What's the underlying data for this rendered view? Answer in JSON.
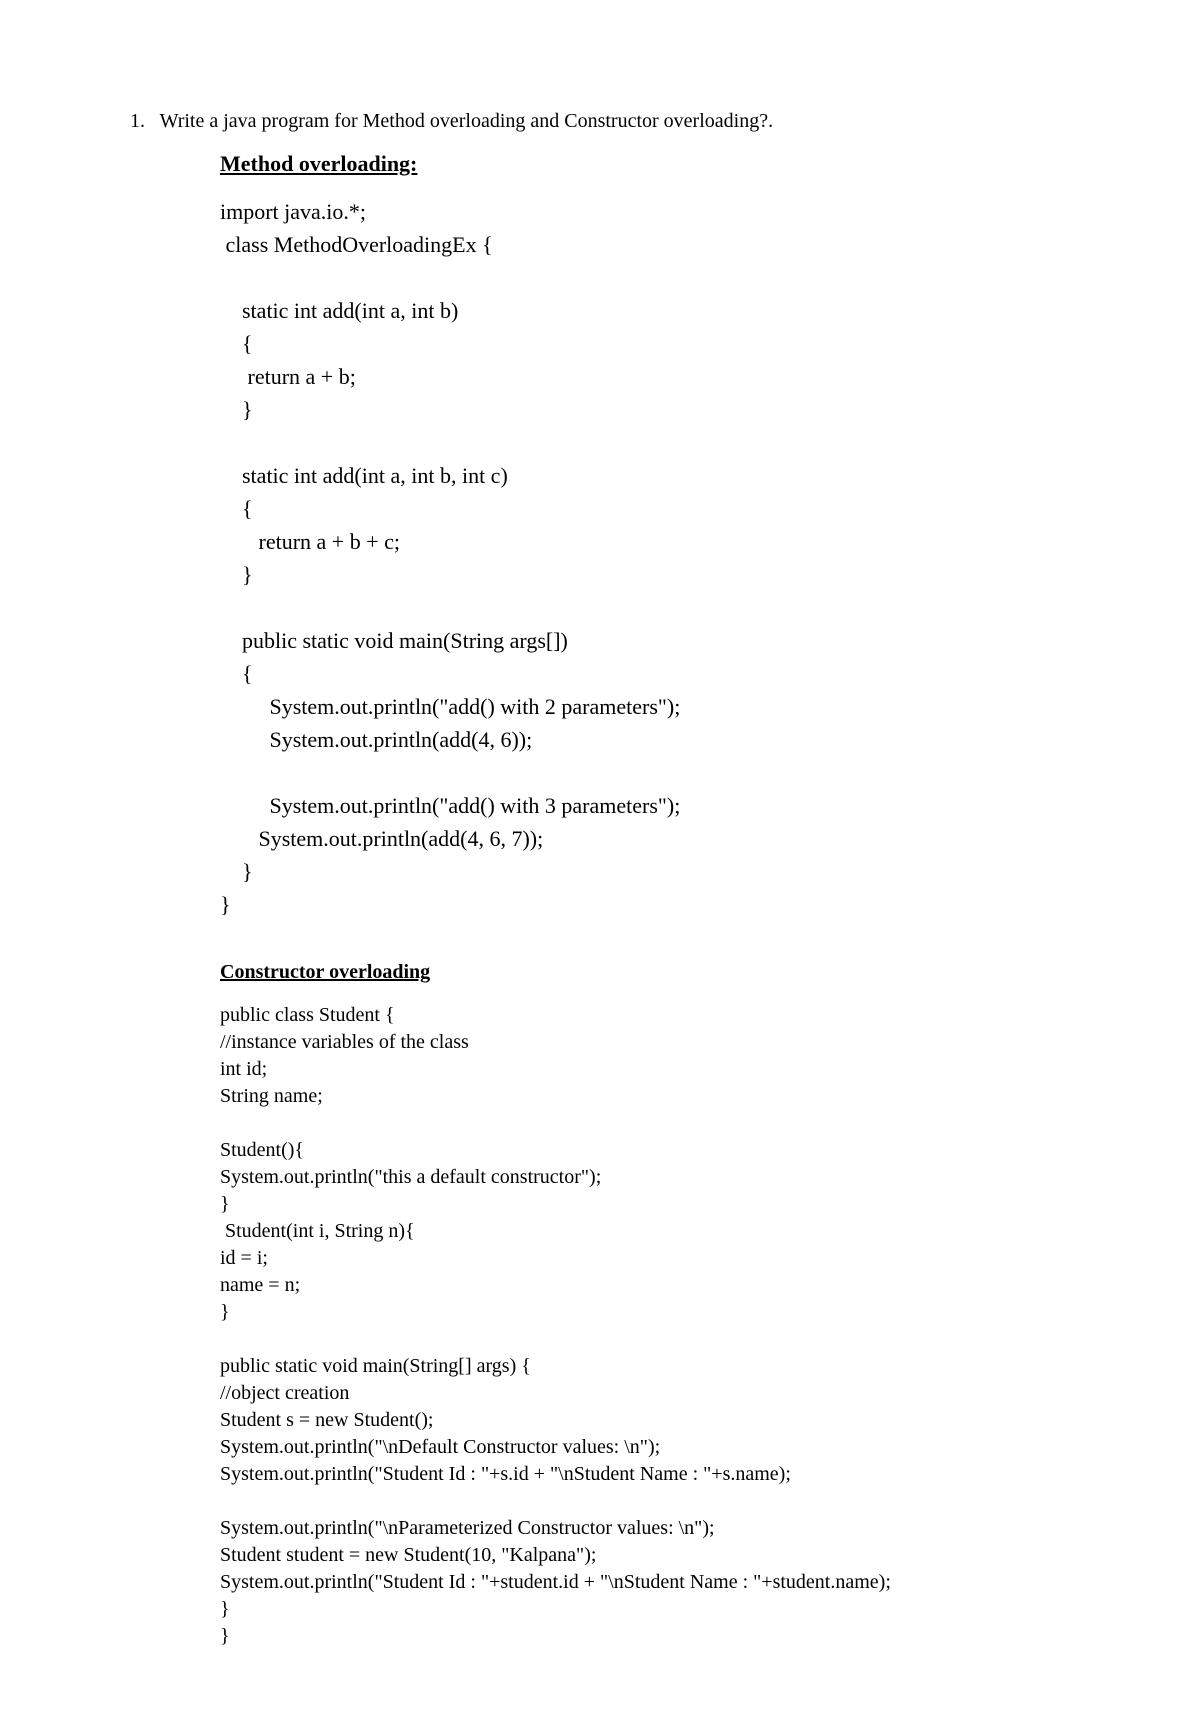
{
  "question": {
    "number": "1.",
    "text": "Write a java program for Method overloading and Constructor overloading?."
  },
  "section1": {
    "heading": "Method overloading:",
    "code": "import java.io.*;\n class MethodOverloadingEx {\n\n    static int add(int a, int b)\n    {\n     return a + b;\n    }\n\n    static int add(int a, int b, int c)\n    {\n       return a + b + c;\n    }\n\n    public static void main(String args[])\n    {\n         System.out.println(\"add() with 2 parameters\");\n         System.out.println(add(4, 6));\n\n         System.out.println(\"add() with 3 parameters\");\n       System.out.println(add(4, 6, 7));\n    }\n}"
  },
  "section2": {
    "heading": "Constructor overloading",
    "code": "public class Student {\n//instance variables of the class\nint id;\nString name;\n\nStudent(){\nSystem.out.println(\"this a default constructor\");\n}\n Student(int i, String n){\nid = i;\nname = n;\n}\n\npublic static void main(String[] args) {\n//object creation\nStudent s = new Student();\nSystem.out.println(\"\\nDefault Constructor values: \\n\");\nSystem.out.println(\"Student Id : \"+s.id + \"\\nStudent Name : \"+s.name);\n\nSystem.out.println(\"\\nParameterized Constructor values: \\n\");\nStudent student = new Student(10, \"Kalpana\");\nSystem.out.println(\"Student Id : \"+student.id + \"\\nStudent Name : \"+student.name);\n}\n}"
  }
}
